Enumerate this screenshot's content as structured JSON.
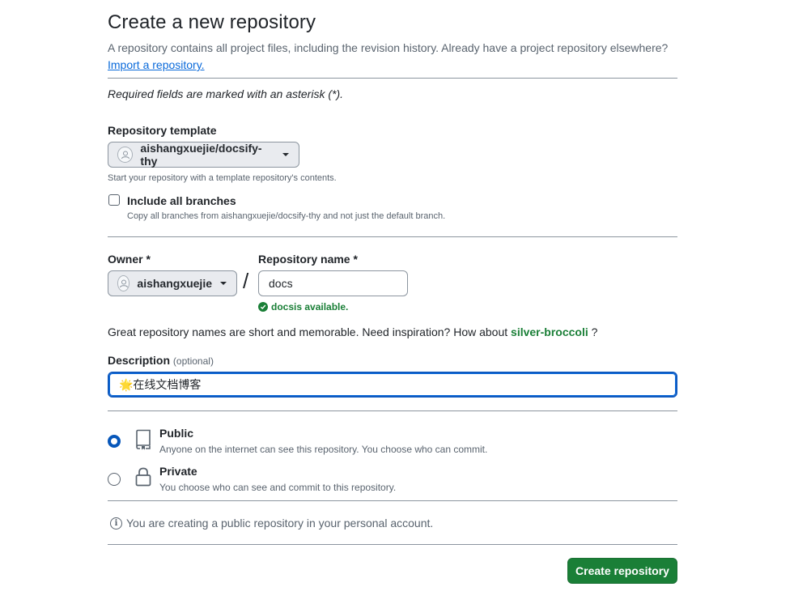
{
  "header": {
    "title": "Create a new repository",
    "intro": "A repository contains all project files, including the revision history. Already have a project repository elsewhere?",
    "import_link": "Import a repository."
  },
  "required_note": "Required fields are marked with an asterisk (*).",
  "template": {
    "label": "Repository template",
    "selected": "aishangxuejie/docsify-thy",
    "hint": "Start your repository with a template repository's contents.",
    "include_branches_label": "Include all branches",
    "include_branches_hint": "Copy all branches from aishangxuejie/docsify-thy and not just the default branch.",
    "include_branches_checked": false
  },
  "owner": {
    "label": "Owner *",
    "selected": "aishangxuejie"
  },
  "repo_name": {
    "label": "Repository name *",
    "value": "docs",
    "availability_name": "docs",
    "availability_text": " is available."
  },
  "suggestion": {
    "text": "Great repository names are short and memorable. Need inspiration? How about ",
    "name": "silver-broccoli",
    "suffix": " ?"
  },
  "description": {
    "label": "Description",
    "optional": "(optional)",
    "value": "🌟在线文档博客"
  },
  "visibility": {
    "public_title": "Public",
    "public_desc": "Anyone on the internet can see this repository. You choose who can commit.",
    "private_title": "Private",
    "private_desc": "You choose who can see and commit to this repository.",
    "selected": "public"
  },
  "info_text": "You are creating a public repository in your personal account.",
  "create_button": "Create repository",
  "colors": {
    "accent": "#0969da",
    "success": "#1a7f37",
    "button_primary": "#1a7f37"
  }
}
